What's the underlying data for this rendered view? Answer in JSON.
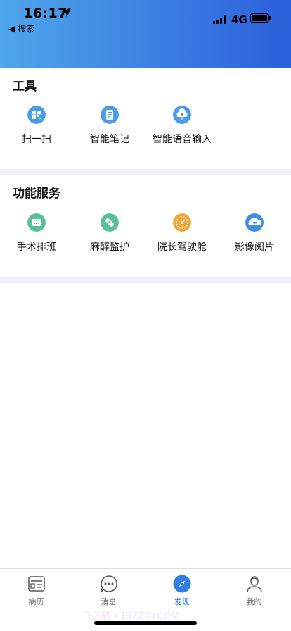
{
  "status_bar": {
    "time": "16:17",
    "network": "4G",
    "back_label": "搜索"
  },
  "sections": {
    "tools": {
      "title": "工具",
      "items": [
        {
          "label": "扫一扫",
          "icon": "qr-scan-icon"
        },
        {
          "label": "智能笔记",
          "icon": "smart-note-icon"
        },
        {
          "label": "智能语音输入",
          "icon": "voice-input-icon"
        }
      ]
    },
    "services": {
      "title": "功能服务",
      "items": [
        {
          "label": "手术排班",
          "icon": "surgery-schedule-icon"
        },
        {
          "label": "麻醉监护",
          "icon": "anesthesia-monitor-icon"
        },
        {
          "label": "院长驾驶舱",
          "icon": "dashboard-gauge-icon"
        },
        {
          "label": "影像阅片",
          "icon": "imaging-cloud-icon"
        }
      ]
    }
  },
  "tabbar": {
    "tabs": [
      {
        "label": "病历",
        "icon": "medical-record-icon"
      },
      {
        "label": "消息",
        "icon": "message-icon"
      },
      {
        "label": "发现",
        "icon": "compass-icon",
        "active": true
      },
      {
        "label": "我的",
        "icon": "profile-icon"
      }
    ]
  },
  "watermark": "飞飞载 • BYFZXY.COM",
  "colors": {
    "header_gradient_start": "#4fa6ea",
    "header_gradient_end": "#2c5fdc",
    "tool_icon_blue": "#4a9be8",
    "service_icon_green": "#5bbf9a",
    "service_icon_orange": "#f0a63a",
    "service_icon_blue": "#3d8fe3",
    "tab_active": "#2f7ee0"
  }
}
